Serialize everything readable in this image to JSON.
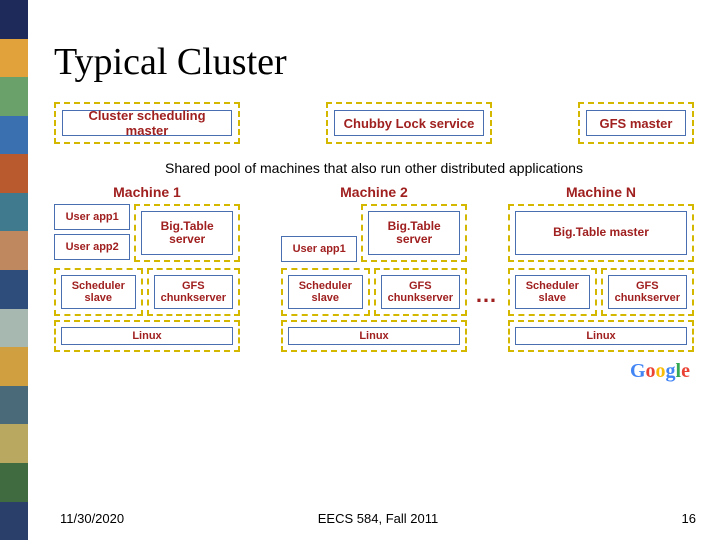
{
  "title": "Typical Cluster",
  "top_services": {
    "cluster_scheduler": "Cluster scheduling master",
    "chubby": "Chubby Lock service",
    "gfs_master": "GFS master"
  },
  "shared_pool_note": "Shared pool of machines that also run other distributed applications",
  "machines": [
    {
      "label": "Machine 1",
      "apps": [
        "User app1",
        "User app2"
      ],
      "bigtable": "Big.Table server",
      "scheduler_slave": "Scheduler slave",
      "gfs_chunkserver": "GFS chunkserver",
      "os": "Linux"
    },
    {
      "label": "Machine 2",
      "apps": [
        "User app1"
      ],
      "bigtable": "Big.Table server",
      "scheduler_slave": "Scheduler slave",
      "gfs_chunkserver": "GFS chunkserver",
      "os": "Linux"
    },
    {
      "label": "Machine N",
      "bigtable_master": "Big.Table master",
      "scheduler_slave": "Scheduler slave",
      "gfs_chunkserver": "GFS chunkserver",
      "os": "Linux"
    }
  ],
  "ellipsis": "…",
  "logo": {
    "g": "G",
    "o1": "o",
    "o2": "o",
    "g2": "g",
    "l": "l",
    "e": "e"
  },
  "footer": {
    "date": "11/30/2020",
    "course": "EECS 584, Fall 2011",
    "page": "16"
  }
}
